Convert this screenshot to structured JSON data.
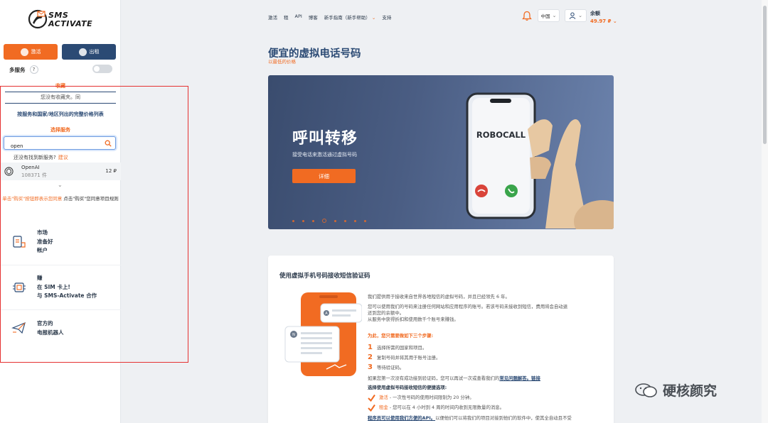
{
  "sidebar": {
    "logo_line1": "SMS",
    "logo_line2": "ACTIVATE",
    "activate_label": "激活",
    "rent_label": "出租",
    "multi_service_label": "多服务",
    "multi_help": "?",
    "favorites_title": "收藏",
    "favorites_empty": "您没有收藏夹。同",
    "price_list_link": "按服务和国家/地区列出的完整价格列表",
    "select_service_title": "选择服务",
    "search_value": "open",
    "not_found_text": "还没有找到新服务?",
    "not_found_link": "建议",
    "service": {
      "name": "OpenAI",
      "count": "108371 件",
      "price": "12 ₽"
    },
    "hint_orange": "单击\"购买\"按钮即表示您同意",
    "hint_dark": "点击\"购买\"您同意项目规则",
    "promos": [
      {
        "lines": [
          "市场",
          "准备好",
          "帐户"
        ],
        "icon": "market-icon"
      },
      {
        "lines": [
          "赚",
          "在 SIM 卡上!",
          "与 SMS-Activate 合作"
        ],
        "icon": "sim-chip-icon"
      },
      {
        "lines": [
          "官方的",
          "电报机器人"
        ],
        "icon": "telegram-icon"
      }
    ]
  },
  "nav": {
    "items": [
      "激活",
      "租",
      "API",
      "博客",
      "新手指南（新手帮助）",
      "支持"
    ],
    "lang": "中国",
    "balance_label": "余额",
    "balance_value": "49.97 ₽"
  },
  "hero": {
    "title": "便宜的虚拟电话号码",
    "subtitle": "以最低的价格",
    "banner_title": "呼叫转移",
    "banner_sub": "接受电话来激活通过虚拟号码",
    "banner_button": "详细",
    "phone_label": "ROBOCALL"
  },
  "card": {
    "title": "使用虚拟手机号码接收短信验证码",
    "p1": "我们提供用于接收来自世界各地短信的虚拟号码，并且已经领先 6 年。",
    "p2": "您可以使用我们的号码来注册任何网站和应用程序的账号。若该号码未接收到短信，费用将会自动退",
    "p2b": "还到您的余额中。",
    "p3": "从服务中获得折扣和使用数千个账号来赚钱。",
    "steps_title": "为此，您只需要做如下三个步骤:",
    "steps": [
      "选择所需的国家和项目。",
      "复制号码并将其用于账号注册。",
      "等待验证码。"
    ],
    "p4": "如果您第一次没有成功接到验证码，您可以再试一次或查看我们的",
    "p4_link": "常见问题解答。链接",
    "options_title": "选择使用虚拟号码接收短信的便捷选项:",
    "opt1_key": "激活",
    "opt1_val": " - 一次性号码的使用时间限制为 20 分钟。",
    "opt2_key": "租金",
    "opt2_val": " - 您可以在 4 小时到 4 周的时间内收到无限数量的消息。",
    "p5_link": "程序员可以使用我们方便的API。",
    "p5": "以便他们可以将我们的项目对接到他们的软件中，使其全自动且不受"
  },
  "watermark": "硬核颜究",
  "colors": {
    "accent": "#f16b22",
    "primary": "#2b4a74",
    "frame": "#e53232"
  }
}
